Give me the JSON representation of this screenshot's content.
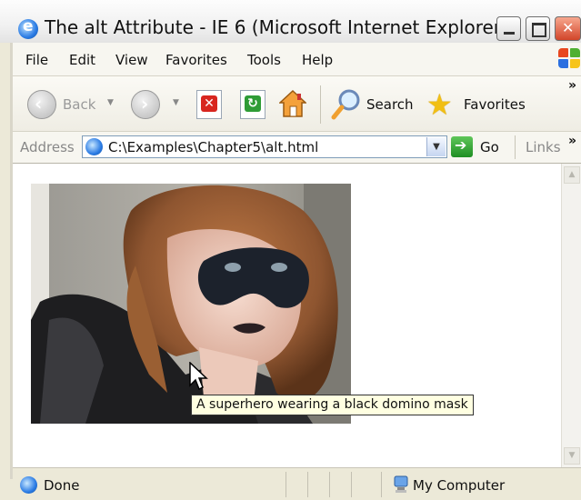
{
  "window": {
    "title": "The alt Attribute - IE 6 (Microsoft Internet Explorer)"
  },
  "menu": [
    {
      "label": "File"
    },
    {
      "label": "Edit"
    },
    {
      "label": "View"
    },
    {
      "label": "Favorites"
    },
    {
      "label": "Tools"
    },
    {
      "label": "Help"
    }
  ],
  "toolbar": {
    "back_label": "Back",
    "search_label": "Search",
    "favorites_label": "Favorites"
  },
  "address": {
    "label": "Address",
    "value": "C:\\Examples\\Chapter5\\alt.html",
    "go_label": "Go",
    "links_label": "Links"
  },
  "content": {
    "tooltip": "A superhero wearing a black domino mask"
  },
  "status": {
    "text": "Done",
    "zone": "My Computer"
  }
}
